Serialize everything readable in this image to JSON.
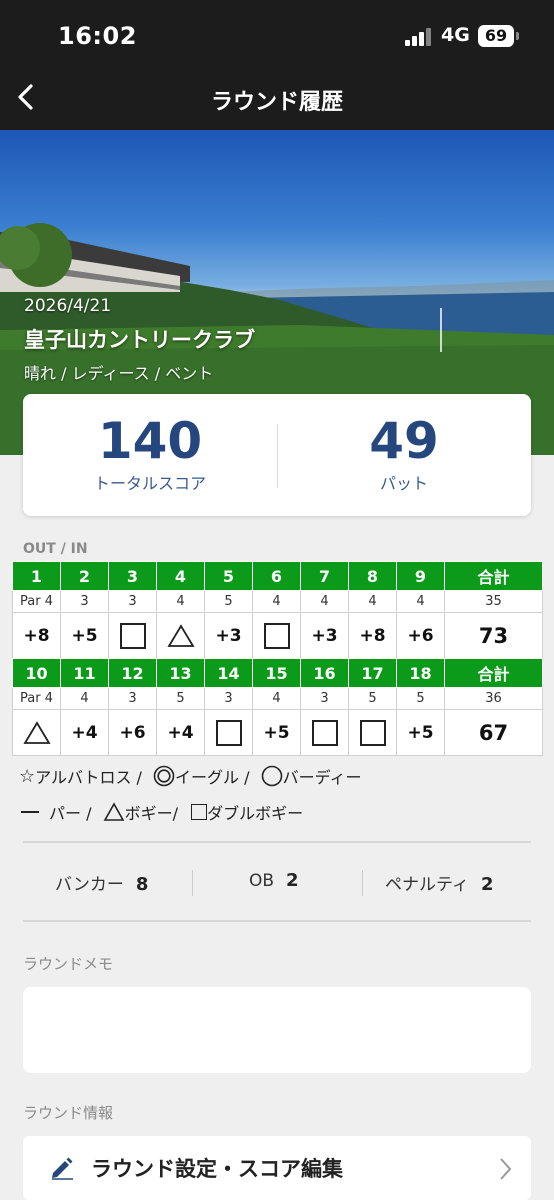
{
  "status": {
    "time": "16:02",
    "network": "4G",
    "battery": "69"
  },
  "nav": {
    "title": "ラウンド履歴"
  },
  "round": {
    "date": "2026/4/21",
    "course": "皇子山カントリークラブ",
    "conditions": "晴れ / レディース  / ベント"
  },
  "summary": {
    "total_score": "140",
    "total_label": "トータルスコア",
    "putts": "49",
    "putts_label": "パット"
  },
  "scorecard": {
    "section_label": "OUT / IN",
    "total_label": "合計",
    "out": {
      "holes": [
        "1",
        "2",
        "3",
        "4",
        "5",
        "6",
        "7",
        "8",
        "9"
      ],
      "pars": [
        "Par 4",
        "3",
        "3",
        "4",
        "5",
        "4",
        "4",
        "4",
        "4"
      ],
      "par_total": "35",
      "scores": [
        "+8",
        "+5",
        "square",
        "triangle",
        "+3",
        "square",
        "+3",
        "+8",
        "+6"
      ],
      "total": "73"
    },
    "in": {
      "holes": [
        "10",
        "11",
        "12",
        "13",
        "14",
        "15",
        "16",
        "17",
        "18"
      ],
      "pars": [
        "Par 4",
        "4",
        "3",
        "5",
        "3",
        "4",
        "3",
        "5",
        "5"
      ],
      "par_total": "36",
      "scores": [
        "triangle",
        "+4",
        "+6",
        "+4",
        "square",
        "+5",
        "square",
        "square",
        "+5"
      ],
      "total": "67"
    }
  },
  "legend": {
    "albatross": "アルバトロス /",
    "eagle": "イーグル /",
    "birdie": "バーディー",
    "par": "パー /",
    "bogey": "ボギー/",
    "double_bogey": "ダブルボギー"
  },
  "stats": {
    "bunker_label": "バンカー",
    "bunker": "8",
    "ob_label": "OB",
    "ob": "2",
    "penalty_label": "ペナルティ",
    "penalty": "2"
  },
  "memo": {
    "label": "ラウンドメモ",
    "text": ""
  },
  "info": {
    "label": "ラウンド情報",
    "edit_label": "ラウンド設定・スコア編集"
  },
  "colors": {
    "accent_green": "#0c9a1a",
    "score_blue": "#26477e",
    "nav_bg": "#1c1c1c"
  }
}
